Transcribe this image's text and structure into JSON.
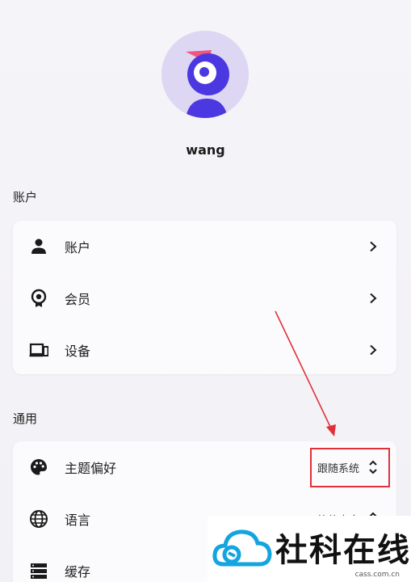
{
  "profile": {
    "username": "wang"
  },
  "sections": {
    "account_title": "账户",
    "general_title": "通用"
  },
  "account_items": [
    {
      "label": "账户",
      "icon": "person-icon"
    },
    {
      "label": "会员",
      "icon": "membership-badge-icon"
    },
    {
      "label": "设备",
      "icon": "devices-icon"
    }
  ],
  "general_items": [
    {
      "label": "主题偏好",
      "icon": "palette-icon",
      "value": "跟随系统"
    },
    {
      "label": "语言",
      "icon": "globe-icon",
      "value": "简体中文"
    },
    {
      "label": "缓存",
      "icon": "storage-icon"
    }
  ],
  "watermark": {
    "name": "社科在线",
    "url": "cass.com.cn"
  },
  "colors": {
    "highlight": "#e0313a",
    "avatar_primary": "#4b38e0",
    "avatar_accent": "#f0567e"
  }
}
